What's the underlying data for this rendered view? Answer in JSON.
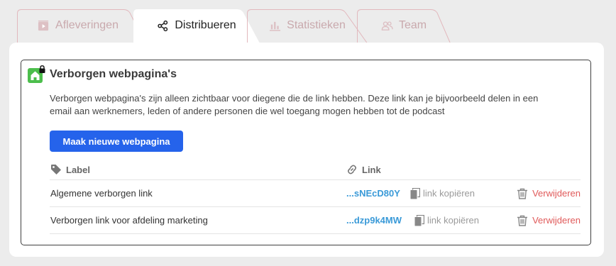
{
  "tabs": [
    {
      "label": "Afleveringen",
      "icon": "play-square-icon",
      "active": false
    },
    {
      "label": "Distribueren",
      "icon": "share-icon",
      "active": true
    },
    {
      "label": "Statistieken",
      "icon": "bar-chart-icon",
      "active": false
    },
    {
      "label": "Team",
      "icon": "users-icon",
      "active": false
    }
  ],
  "section": {
    "title": "Verborgen webpagina's",
    "icon": "home-lock-icon",
    "description": "Verborgen webpagina's zijn alleen zichtbaar voor diegene die de link hebben. Deze link kan je bijvoorbeeld delen in een email aan werknemers, leden of andere personen die wel toegang mogen hebben tot de podcast",
    "create_button": "Maak nieuwe webpagina"
  },
  "table": {
    "headers": {
      "label": "Label",
      "link": "Link"
    },
    "rows": [
      {
        "label": "Algemene verborgen link",
        "link": "...sNEcD80Y",
        "copy": "link kopiëren",
        "delete": "Verwijderen"
      },
      {
        "label": "Verborgen link voor afdeling marketing",
        "link": "...dzp9k4MW",
        "copy": "link kopiëren",
        "delete": "Verwijderen"
      }
    ]
  },
  "colors": {
    "accent": "#2563eb",
    "link": "#3a9ad8",
    "danger": "#e05a5a",
    "logo": "#4cbe4c"
  }
}
